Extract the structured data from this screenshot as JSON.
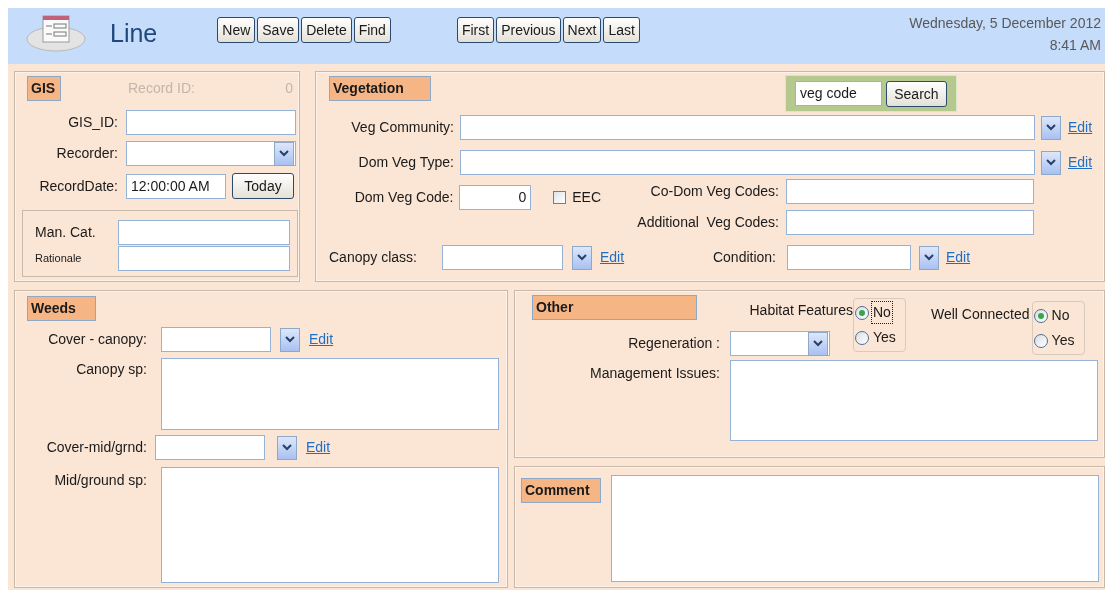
{
  "header": {
    "title": "Line",
    "record_buttons": [
      {
        "label": "New"
      },
      {
        "label": "Save"
      },
      {
        "label": "Delete"
      },
      {
        "label": "Find"
      }
    ],
    "nav_buttons": [
      {
        "label": "First"
      },
      {
        "label": "Previous"
      },
      {
        "label": "Next"
      },
      {
        "label": "Last"
      }
    ],
    "date": "Wednesday, 5 December 2012",
    "time": "8:41 AM"
  },
  "gis": {
    "heading": "GIS",
    "record_id": {
      "label": "Record ID:",
      "value": "0",
      "disabled": true
    },
    "gis_id": {
      "label": "GIS_ID:"
    },
    "recorder": {
      "label": "Recorder:"
    },
    "record_date": {
      "label": "RecordDate:",
      "value": "12:00:00 AM",
      "button": "Today"
    },
    "man_cat": {
      "label": "Man. Cat."
    },
    "rationale": {
      "label": "Rationale"
    }
  },
  "vegetation": {
    "heading": "Vegetation",
    "search": {
      "value": "veg code",
      "button": "Search"
    },
    "veg_community": {
      "label": "Veg Community:",
      "link": "Edit"
    },
    "dom_veg_type": {
      "label": "Dom Veg Type:",
      "link": "Edit"
    },
    "dom_veg_code": {
      "label": "Dom Veg Code:",
      "value": "0"
    },
    "eec": {
      "label": "EEC",
      "checked": false
    },
    "co_dom_veg_codes": {
      "label": "Co-Dom Veg Codes:"
    },
    "additional_veg_codes": {
      "label": "Additional  Veg Codes:"
    },
    "canopy_class": {
      "label": "Canopy class:",
      "link": "Edit"
    },
    "condition": {
      "label": "Condition:",
      "link": "Edit"
    }
  },
  "weeds": {
    "heading": "Weeds",
    "cover_canopy": {
      "label": "Cover - canopy:",
      "link": "Edit"
    },
    "canopy_sp": {
      "label": "Canopy sp:"
    },
    "cover_mid_grnd": {
      "label": "Cover-mid/grnd:",
      "link": "Edit"
    },
    "mid_ground_sp": {
      "label": "Mid/ground sp:"
    }
  },
  "other": {
    "heading": "Other",
    "habitat_features": {
      "label": "Habitat Features",
      "options": [
        {
          "label": "No",
          "selected": true,
          "focused": true
        },
        {
          "label": "Yes",
          "selected": false,
          "focused": false
        }
      ]
    },
    "well_connected": {
      "label": "Well Connected",
      "options": [
        {
          "label": "No",
          "selected": true,
          "focused": false
        },
        {
          "label": "Yes",
          "selected": false,
          "focused": false
        }
      ]
    },
    "regeneration": {
      "label": "Regeneration :"
    },
    "management_issues": {
      "label": "Management Issues:"
    }
  },
  "comment": {
    "heading": "Comment"
  }
}
